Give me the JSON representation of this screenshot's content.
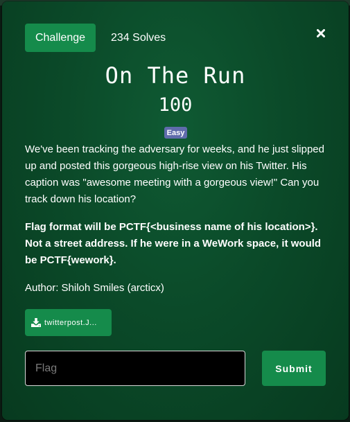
{
  "header": {
    "tab_challenge_label": "Challenge",
    "tab_solves_label": "234 Solves",
    "close_icon": "close-icon"
  },
  "challenge": {
    "title": "On The Run",
    "points": "100",
    "difficulty": "Easy",
    "description_paragraph_1": "We've been tracking the adversary for weeks, and he just slipped up and posted this gorgeous high-rise view on his Twitter. His caption was \"awesome meeting with a gorgeous view!\" Can you track down his location?",
    "description_paragraph_2": "Flag format will be PCTF{<business name of his location>}. Not a street address. If he were in a WeWork space, it would be PCTF{wework}.",
    "author": "Author: Shiloh Smiles (arcticx)"
  },
  "file": {
    "name": "twitterpost.J...",
    "icon": "download-icon"
  },
  "form": {
    "flag_value": "",
    "flag_placeholder": "Flag",
    "submit_label": "Submit"
  },
  "colors": {
    "accent": "#158b4b",
    "modal_bg": "#0b4a29",
    "badge": "#5f6bab"
  }
}
